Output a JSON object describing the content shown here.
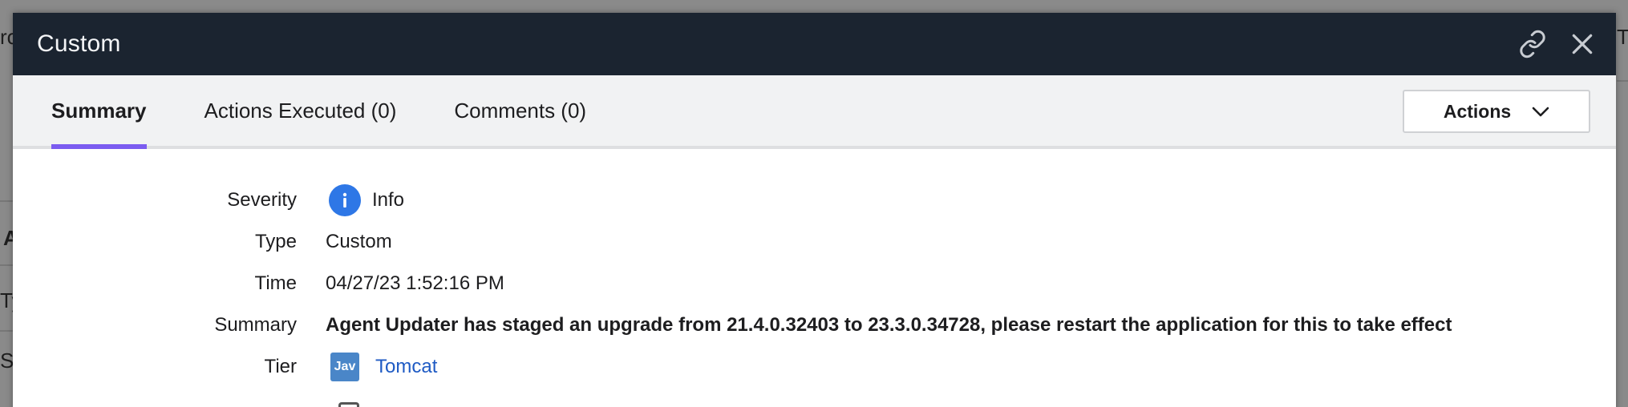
{
  "background": {
    "fragments": [
      "ro",
      "A",
      "Ty",
      "Slo",
      "Tr"
    ]
  },
  "modal": {
    "title": "Custom",
    "icons": {
      "link": "link-icon",
      "close": "close-icon"
    },
    "tabs": [
      {
        "label": "Summary",
        "active": true
      },
      {
        "label": "Actions Executed (0)",
        "active": false
      },
      {
        "label": "Comments (0)",
        "active": false
      }
    ],
    "actions_button": {
      "label": "Actions",
      "icon": "chevron-down-icon"
    },
    "accent_color": "#7b5cf0",
    "fields": {
      "severity": {
        "label": "Severity",
        "value": "Info",
        "icon": "info-icon",
        "color": "#2e77e6"
      },
      "type": {
        "label": "Type",
        "value": "Custom"
      },
      "time": {
        "label": "Time",
        "value": "04/27/23 1:52:16 PM"
      },
      "summary": {
        "label": "Summary",
        "value": "Agent Updater has staged an upgrade from 21.4.0.32403 to 23.3.0.34728, please restart the application for this to take effect"
      },
      "tier": {
        "label": "Tier",
        "badge": "Jav",
        "value": "Tomcat",
        "icon": "java-icon"
      }
    }
  }
}
